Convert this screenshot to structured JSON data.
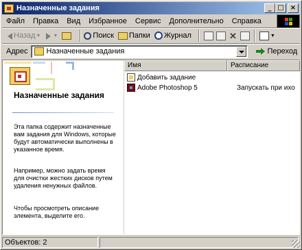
{
  "window": {
    "title": "Назначенные задания",
    "controls": {
      "minimize": "_",
      "maximize": "□",
      "close": "×"
    }
  },
  "menubar": {
    "items": [
      {
        "label": "Файл",
        "name": "menu-file"
      },
      {
        "label": "Правка",
        "name": "menu-edit"
      },
      {
        "label": "Вид",
        "name": "menu-view"
      },
      {
        "label": "Избранное",
        "name": "menu-favorites"
      },
      {
        "label": "Сервис",
        "name": "menu-tools"
      },
      {
        "label": "Дополнительно",
        "name": "menu-advanced"
      },
      {
        "label": "Справка",
        "name": "menu-help"
      }
    ]
  },
  "toolbar": {
    "back_label": "Назад",
    "search_label": "Поиск",
    "folders_label": "Папки",
    "history_label": "Журнал"
  },
  "address": {
    "label": "Адрес",
    "value": "Назначенные задания",
    "go_label": "Переход"
  },
  "left_pane": {
    "title": "Назначенные задания",
    "paragraphs": [
      "Эта папка содержит назначенные вам задания для Windows, которые будут автоматически выполнены в указанное время.",
      "Например, можно задать время для очистки жестких дисков путем удаления ненужных файлов.",
      "Чтобы просмотреть описание элемента, выделите его."
    ]
  },
  "list": {
    "columns": [
      "Имя",
      "Расписание"
    ],
    "rows": [
      {
        "name": "Добавить задание",
        "schedule": "",
        "icon": "add-task-icon"
      },
      {
        "name": "Adobe Photoshop 5",
        "schedule": "Запускать при ихо",
        "icon": "photoshop-icon"
      }
    ]
  },
  "status": {
    "objects": "Объектов: 2"
  },
  "colors": {
    "titlebar_start": "#0a246a",
    "titlebar_end": "#a6caf0",
    "face": "#d4d0c8"
  }
}
